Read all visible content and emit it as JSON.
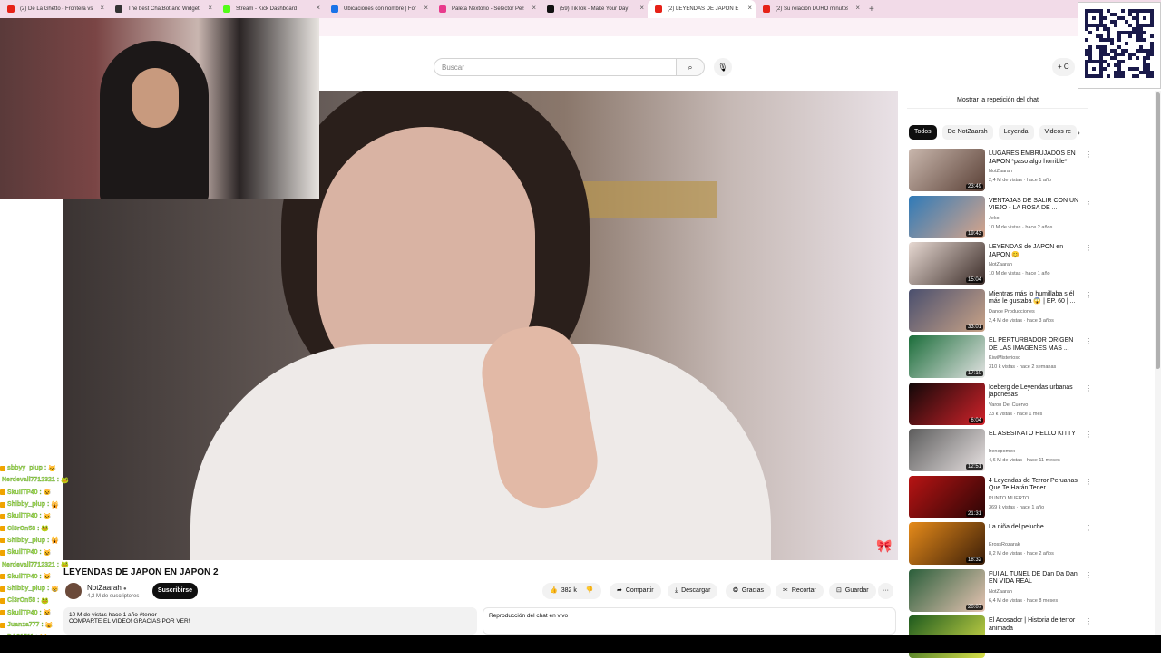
{
  "tabs": [
    {
      "title": "(2) De La Ghetto - Frontera vs",
      "color": "#e62117"
    },
    {
      "title": "The best ChatBot and Widgets",
      "color": "#333333"
    },
    {
      "title": "Stream - Kick Dashboard",
      "color": "#53fc18"
    },
    {
      "title": "Ubicaciones con nombre | Form",
      "color": "#1a73e8"
    },
    {
      "title": "Paleta Nextorio - Selector Pers",
      "color": "#e83a8c"
    },
    {
      "title": "(59) TikTok - Make Your Day",
      "color": "#111111"
    },
    {
      "title": "(2) LEYENDAS DE JAPON E",
      "color": "#e62117",
      "active": true
    },
    {
      "title": "(2) Su relación DURÓ minutos",
      "color": "#e62117"
    }
  ],
  "new_tab_label": "+",
  "search": {
    "placeholder": "Buscar",
    "search_icon": "⌕",
    "mic_icon": "🎙"
  },
  "create_label": "+ C",
  "video": {
    "title": "LEYENDAS DE JAPON EN JAPON 2",
    "channel": "NotZaarah",
    "verified": "●",
    "subscribers": "4,2 M de suscriptores",
    "subscribe_label": "Suscribirse",
    "likes": "382 k",
    "share_label": "Compartir",
    "download_label": "Descargar",
    "thanks_label": "Gracias",
    "clip_label": "Recortar",
    "save_label": "Guardar",
    "more_label": "···",
    "views_date": "10 M de vistas  hace 1 año  #terror",
    "description": "COMPARTE EL VIDEO! GRACIAS POR VER!",
    "emoji": "🎀"
  },
  "chat_replay": {
    "label": "Reproducción del chat en vivo"
  },
  "sidebar": {
    "show_chat_label": "Mostrar la repetición del chat",
    "chips": [
      "Todos",
      "De NotZaarah",
      "Leyenda",
      "Videos re"
    ],
    "chip_next": "›",
    "recs": [
      {
        "title": "LUGARES EMBRUJADOS EN JAPON *paso algo horrible*",
        "channel": "NotZaarah",
        "meta": "2,4 M de vistas · hace 1 año",
        "dur": "23:49",
        "c1": "#c9b7ad",
        "c2": "#5a4036"
      },
      {
        "title": "VENTAJAS DE SALIR CON UN VIEJO - LA ROSA DE ...",
        "channel": "Jeko",
        "meta": "10 M de vistas · hace 2 años",
        "dur": "19:43",
        "c1": "#2f7ab8",
        "c2": "#d9a58a"
      },
      {
        "title": "LEYENDAS de JAPON en JAPON 😊",
        "channel": "NotZaarah",
        "meta": "10 M de vistas · hace 1 año",
        "dur": "15:04",
        "c1": "#e7d9d2",
        "c2": "#3a2b27"
      },
      {
        "title": "Mientras más lo humillaba s él más le gustaba 😱 | EP. 60 | ...",
        "channel": "Dance Producciones",
        "meta": "2,4 M de vistas · hace 3 años",
        "dur": "33:01",
        "c1": "#4a4f6e",
        "c2": "#c9a387"
      },
      {
        "title": "EL PERTURBADOR ORIGEN DE LAS IMAGENES MAS ...",
        "channel": "KiwiMisterioso",
        "meta": "310 k vistas · hace 2 semanas",
        "dur": "17:10",
        "c1": "#1b6d3a",
        "c2": "#e3e3e3"
      },
      {
        "title": "Iceberg de Leyendas urbanas japonesas",
        "channel": "Varon Del Cuervo",
        "meta": "23 k vistas · hace 1 mes",
        "dur": "6:04",
        "c1": "#100808",
        "c2": "#d1222a"
      },
      {
        "title": "EL ASESINATO HELLO KITTY",
        "channel": "Irenepomex",
        "meta": "4,6 M de vistas · hace 11 meses",
        "dur": "12:51",
        "c1": "#5c5c5c",
        "c2": "#e8e2e2"
      },
      {
        "title": "4 Leyendas de Terror Peruanas Que Te Harán Tener ...",
        "channel": "PUNTO MUERTO",
        "meta": "369 k vistas · hace 1 año",
        "dur": "21:31",
        "c1": "#b81414",
        "c2": "#2a0505"
      },
      {
        "title": "La niña del peluche",
        "channel": "ErossRozarak",
        "meta": "8,2 M de vistas · hace 2 años",
        "dur": "18:32",
        "c1": "#e68b1a",
        "c2": "#3a1d08"
      },
      {
        "title": "FUI AL TUNEL DE Dan Da Dan EN VIDA REAL",
        "channel": "NotZaarah",
        "meta": "6,4 M de vistas · hace 8 meses",
        "dur": "20:07",
        "c1": "#2a5e3a",
        "c2": "#e7c4b3"
      },
      {
        "title": "El Acosador | Historia de terror animada",
        "channel": "",
        "meta": "",
        "dur": "",
        "c1": "#1e5a1e",
        "c2": "#d8e04a"
      }
    ]
  },
  "chat": [
    {
      "user": "sbbyy_plup :",
      "emote": "😺"
    },
    {
      "user": "Nerdevall7712321 :",
      "emote": "🐸"
    },
    {
      "user": "SkullTP40 :",
      "emote": "😺"
    },
    {
      "user": "Shibby_plup :",
      "emote": "🙀"
    },
    {
      "user": "SkullTP40 :",
      "emote": "😺"
    },
    {
      "user": "Cl3rOn58 :",
      "emote": "🐸"
    },
    {
      "user": "Shibby_plup :",
      "emote": "🙀"
    },
    {
      "user": "SkullTP40 :",
      "emote": "😺"
    },
    {
      "user": "Nerdevall7712321 :",
      "emote": "🐸"
    },
    {
      "user": "SkullTP40 :",
      "emote": "😺"
    },
    {
      "user": "Shibby_plup :",
      "emote": "😸"
    },
    {
      "user": "Cl3rOn58 :",
      "emote": "🐸"
    },
    {
      "user": "SkullTP40 :",
      "emote": "😺"
    },
    {
      "user": "Juanza777 :",
      "emote": "😺"
    },
    {
      "user": "DA21711 :",
      "emote": "😺"
    }
  ],
  "chat_bottom": {
    "user": "Shibby_plup :",
    "emote": "🐸"
  },
  "colors": {
    "tabstrip": "#f2dbe8",
    "chat_text": "#b8f05a",
    "subscribe_bg": "#0f0f0f"
  }
}
